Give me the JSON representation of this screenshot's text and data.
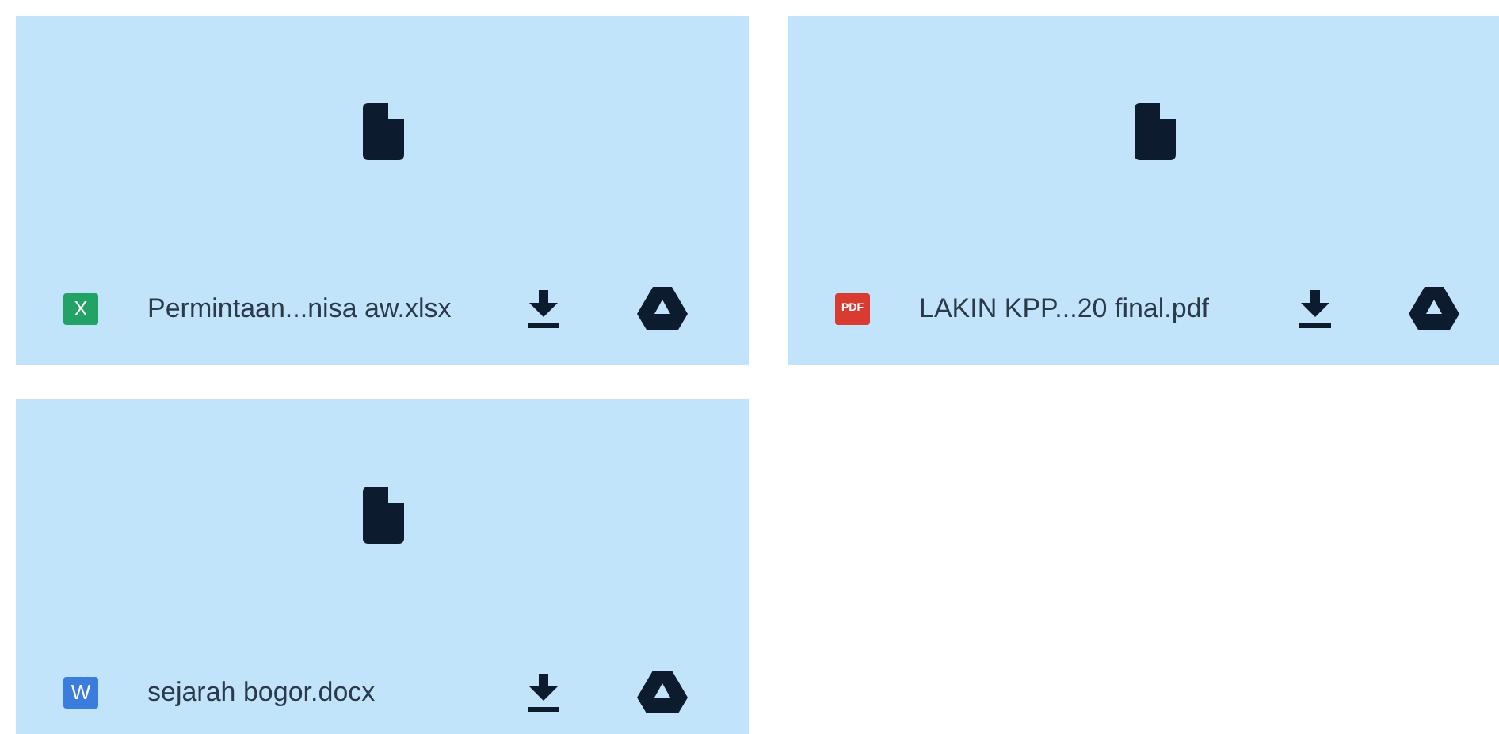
{
  "files": [
    {
      "kind": "xlsx",
      "badge": "X",
      "name": "Permintaan...nisa aw.xlsx"
    },
    {
      "kind": "pdf",
      "badge": "PDF",
      "name": "LAKIN KPP...20 final.pdf"
    },
    {
      "kind": "docx",
      "badge": "W",
      "name": "sejarah bogor.docx"
    }
  ]
}
